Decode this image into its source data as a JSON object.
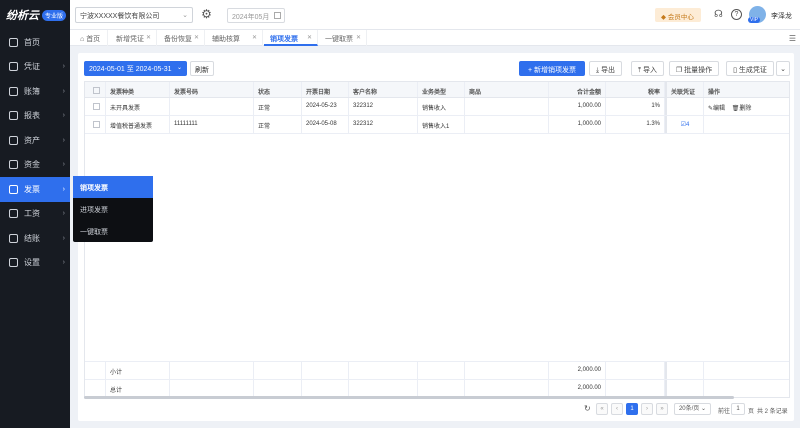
{
  "app": {
    "brand": "纷析云",
    "badge": "专业版"
  },
  "sidebar": {
    "items": [
      {
        "label": "首页",
        "icon": "home-icon"
      },
      {
        "label": "凭证",
        "icon": "voucher-icon"
      },
      {
        "label": "账簿",
        "icon": "ledger-icon"
      },
      {
        "label": "报表",
        "icon": "report-icon"
      },
      {
        "label": "资产",
        "icon": "asset-icon"
      },
      {
        "label": "资金",
        "icon": "fund-icon"
      },
      {
        "label": "发票",
        "icon": "invoice-icon"
      },
      {
        "label": "工资",
        "icon": "salary-icon"
      },
      {
        "label": "结账",
        "icon": "closing-icon"
      },
      {
        "label": "设置",
        "icon": "settings-icon"
      }
    ]
  },
  "submenu": {
    "items": [
      "销项发票",
      "进项发票",
      "一键取票"
    ]
  },
  "topbar": {
    "company": "宁波XXXXX餐饮有限公司",
    "period": "2024年05月",
    "member": "会员中心",
    "user": "李泽龙",
    "vip": "VIP"
  },
  "tabs": [
    {
      "label": "首页"
    },
    {
      "label": "新增凭证"
    },
    {
      "label": "备份恢复"
    },
    {
      "label": "辅助核算"
    },
    {
      "label": "销项发票"
    },
    {
      "label": "一键取票"
    }
  ],
  "toolbar": {
    "daterange": "2024-05-01 至 2024-05-31",
    "refresh": "刷新",
    "add": "+ 新增销项发票",
    "export": "导出",
    "import": "导入",
    "batch": "批量操作",
    "gen_voucher": "生成凭证"
  },
  "table": {
    "headers": [
      "发票种类",
      "发票号码",
      "状态",
      "开票日期",
      "客户名称",
      "业务类型",
      "商品",
      "合计金额",
      "税率",
      "关联凭证",
      "操作"
    ],
    "rows": [
      {
        "type": "未开具发票",
        "number": "",
        "status": "正常",
        "date": "2024-05-23",
        "customer": "322312",
        "biz": "销售收入",
        "goods": "",
        "amount": "1,000.00",
        "rate": "1%",
        "voucher": "",
        "edit": "编辑",
        "del": "删除"
      },
      {
        "type": "增值税普通发票",
        "number": "11111111",
        "status": "正常",
        "date": "2024-05-08",
        "customer": "322312",
        "biz": "销售收入1",
        "goods": "",
        "amount": "1,000.00",
        "rate": "1.3%",
        "voucher": "4",
        "edit": "",
        "del": ""
      }
    ],
    "subtotal_label": "小计",
    "subtotal": "2,000.00",
    "total_label": "总计",
    "total": "2,000.00"
  },
  "pager": {
    "page": "1",
    "page_size": "20条/页",
    "goto_label": "前往",
    "goto_value": "1",
    "page_suffix": "页",
    "total_text": "共 2 条记录"
  }
}
